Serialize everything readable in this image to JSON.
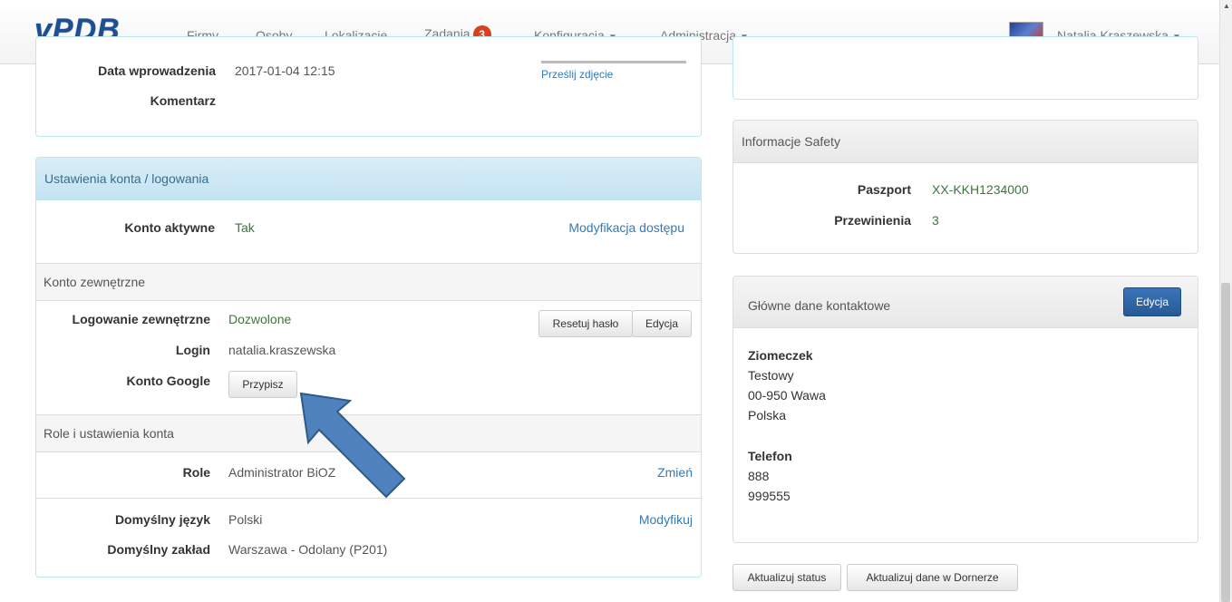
{
  "nav": {
    "brand": "vPDB",
    "items": [
      "Firmy",
      "Osoby",
      "Lokalizacje",
      "Zadania",
      "Konfiguracja",
      "Administracja"
    ],
    "zadania_badge": "3",
    "user": "Natalia Kraszewska"
  },
  "top_panel": {
    "date_label": "Data wprowadzenia",
    "date_value": "2017-01-04 12:15",
    "comment_label": "Komentarz",
    "upload_link": "Prześlij zdjęcie"
  },
  "account": {
    "heading": "Ustawienia konta / logowania",
    "active_label": "Konto aktywne",
    "active_value": "Tak",
    "modify_access": "Modyfikacja dostępu",
    "external_heading": "Konto zewnętrzne",
    "ext_login_label": "Logowanie zewnętrzne",
    "ext_login_value": "Dozwolone",
    "reset_password": "Resetuj hasło",
    "edit": "Edycja",
    "login_label": "Login",
    "login_value": "natalia.kraszewska",
    "google_label": "Konto Google",
    "assign": "Przypisz",
    "roles_heading": "Role i ustawienia konta",
    "role_label": "Role",
    "role_value": "Administrator BiOZ",
    "change": "Zmień",
    "lang_label": "Domyślny język",
    "lang_value": "Polski",
    "modify": "Modyfikuj",
    "plant_label": "Domyślny zakład",
    "plant_value": "Warszawa - Odolany (P201)"
  },
  "safety": {
    "heading": "Informacje Safety",
    "passport_label": "Paszport",
    "passport_value": "XX-KKH1234000",
    "offenses_label": "Przewinienia",
    "offenses_value": "3"
  },
  "contact": {
    "heading": "Główne dane kontaktowe",
    "edit": "Edycja",
    "name": "Ziomeczek",
    "line1": "Testowy",
    "line2": "00-950 Wawa",
    "line3": "Polska",
    "phone_label": "Telefon",
    "phone1": "888",
    "phone2": "999555"
  },
  "bottom_buttons": {
    "update_status": "Aktualizuj status",
    "update_dornerze": "Aktualizuj dane w Dornerze"
  }
}
